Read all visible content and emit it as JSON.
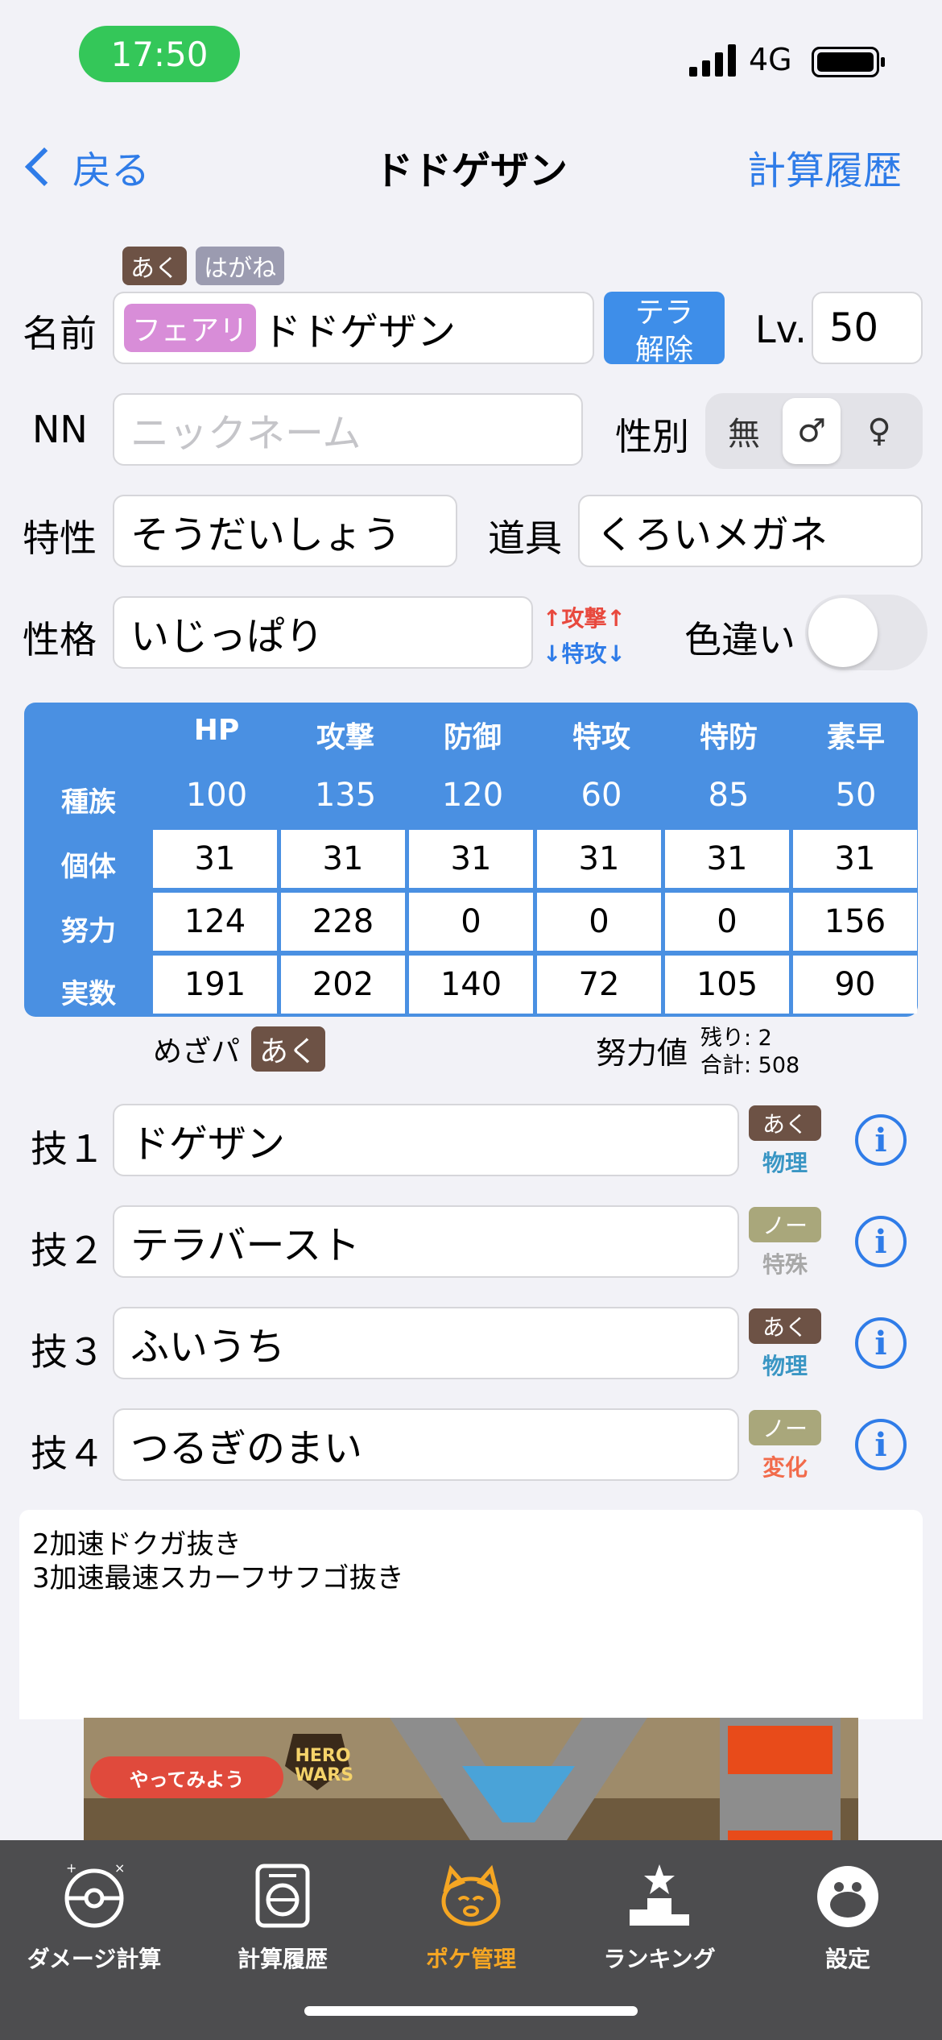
{
  "status": {
    "time": "17:50",
    "network": "4G"
  },
  "nav": {
    "back_label": "戻る",
    "title": "ドドゲザン",
    "right_label": "計算履歴"
  },
  "form": {
    "types": [
      "あく",
      "はがね"
    ],
    "name_label": "名前",
    "tera_type": "フェアリ",
    "name_value": "ドドゲザン",
    "tera_button": [
      "テラ",
      "解除"
    ],
    "level_label": "Lv.",
    "level_value": "50",
    "nn_label": "NN",
    "nn_placeholder": "ニックネーム",
    "gender_label": "性別",
    "gender_options": [
      "無",
      "♂",
      "♀"
    ],
    "gender_selected": "♂",
    "ability_label": "特性",
    "ability_value": "そうだいしょう",
    "item_label": "道具",
    "item_value": "くろいメガネ",
    "nature_label": "性格",
    "nature_value": "いじっぱり",
    "nature_up": "↑攻撃↑",
    "nature_down": "↓特攻↓",
    "shiny_label": "色違い",
    "shiny_on": false
  },
  "stats": {
    "headers": [
      "HP",
      "攻撃",
      "防御",
      "特攻",
      "特防",
      "素早"
    ],
    "row_labels": [
      "種族",
      "個体",
      "努力",
      "実数"
    ],
    "base": [
      "100",
      "135",
      "120",
      "60",
      "85",
      "50"
    ],
    "iv": [
      "31",
      "31",
      "31",
      "31",
      "31",
      "31"
    ],
    "ev": [
      "124",
      "228",
      "0",
      "0",
      "0",
      "156"
    ],
    "actual": [
      "191",
      "202",
      "140",
      "72",
      "105",
      "90"
    ]
  },
  "hidden_power": {
    "label": "めざパ",
    "type": "あく"
  },
  "ev_summary": {
    "label": "努力値",
    "remaining": "残り: 2",
    "total": "合計: 508"
  },
  "moves": [
    {
      "label": "技１",
      "name": "ドゲザン",
      "type": "あく",
      "category": "物理"
    },
    {
      "label": "技２",
      "name": "テラバースト",
      "type": "ノー",
      "category": "特殊"
    },
    {
      "label": "技３",
      "name": "ふいうち",
      "type": "あく",
      "category": "物理"
    },
    {
      "label": "技４",
      "name": "つるぎのまい",
      "type": "ノー",
      "category": "変化"
    }
  ],
  "memo": "2加速ドクガ抜き\n3加速最速スカーフサフゴ抜き",
  "ad": {
    "button": "やってみよう",
    "logo_top": "HERO",
    "logo_bottom": "WARS"
  },
  "tabs": [
    {
      "label": "ダメージ計算",
      "icon": "calculator-ball-icon"
    },
    {
      "label": "計算履歴",
      "icon": "history-icon"
    },
    {
      "label": "ポケ管理",
      "icon": "poke-manage-icon",
      "active": true
    },
    {
      "label": "ランキング",
      "icon": "ranking-icon"
    },
    {
      "label": "設定",
      "icon": "settings-icon"
    }
  ],
  "colors": {
    "accent": "#2f7ce8",
    "stats_bg": "#4a90e2",
    "tab_active": "#f5a623",
    "tab_bg": "#4d4d4f",
    "dark_type": "#6d5245",
    "normal_type": "#a9a77b"
  }
}
